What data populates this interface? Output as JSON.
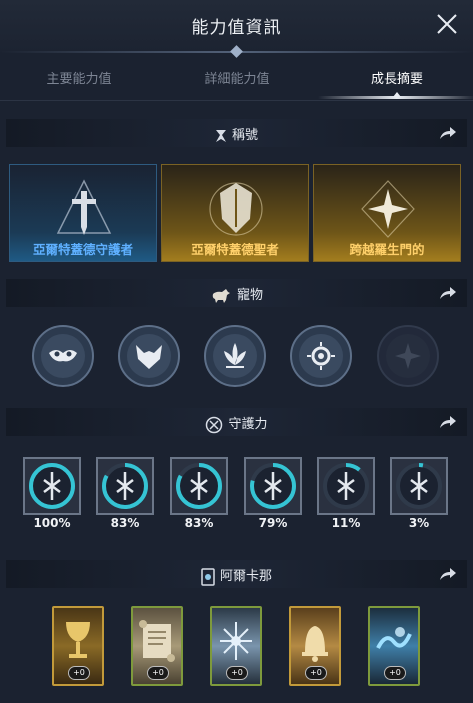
{
  "header": {
    "title": "能力值資訊"
  },
  "tabs": [
    {
      "label": "主要能力值"
    },
    {
      "label": "詳細能力值"
    },
    {
      "label": "成長摘要"
    }
  ],
  "sections": {
    "titles": {
      "label": "稱號"
    },
    "pets": {
      "label": "寵物"
    },
    "guardian": {
      "label": "守護力"
    },
    "arcana": {
      "label": "阿爾卡那"
    }
  },
  "title_cards": [
    {
      "label": "亞爾特蓋德守護者",
      "style": "blue"
    },
    {
      "label": "亞爾特蓋德聖者",
      "style": "gold"
    },
    {
      "label": "跨越羅生門的",
      "style": "gold"
    }
  ],
  "pets": [
    {
      "icon": "mask-pet-icon",
      "owned": true
    },
    {
      "icon": "fox-pet-icon",
      "owned": true
    },
    {
      "icon": "lotus-pet-icon",
      "owned": true
    },
    {
      "icon": "eye-pet-icon",
      "owned": true
    },
    {
      "icon": "star-pet-icon",
      "owned": false
    }
  ],
  "guardians": [
    {
      "percent": "100%",
      "progress": 1.0
    },
    {
      "percent": "83%",
      "progress": 0.83
    },
    {
      "percent": "83%",
      "progress": 0.83
    },
    {
      "percent": "79%",
      "progress": 0.79
    },
    {
      "percent": "11%",
      "progress": 0.11
    },
    {
      "percent": "3%",
      "progress": 0.03
    }
  ],
  "arcana": [
    {
      "badge": "+0",
      "icon": "goblet-card-icon"
    },
    {
      "badge": "+0",
      "icon": "scroll-card-icon"
    },
    {
      "badge": "+0",
      "icon": "frost-card-icon"
    },
    {
      "badge": "+0",
      "icon": "bell-card-icon"
    },
    {
      "badge": "+0",
      "icon": "wave-card-icon"
    }
  ],
  "colors": {
    "background": "#1b2230",
    "accent_blue": "#5fb0ff",
    "accent_gold": "#ffd06a",
    "progress_teal": "#35c4d4"
  }
}
